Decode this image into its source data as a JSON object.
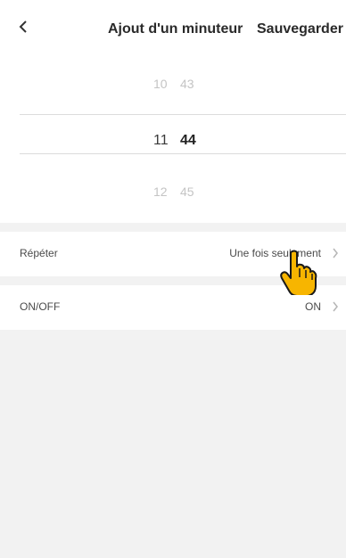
{
  "header": {
    "title": "Ajout d'un minuteur",
    "save_label": "Sauvegarder",
    "back_icon": "chevron-left-icon"
  },
  "time_picker": {
    "rows": [
      {
        "hour": "10",
        "minute": "43",
        "selected": false
      },
      {
        "hour": "11",
        "minute": "44",
        "selected": true
      },
      {
        "hour": "12",
        "minute": "45",
        "selected": false
      }
    ]
  },
  "settings": {
    "repeat": {
      "label": "Répéter",
      "value": "Une fois seulement"
    },
    "onoff": {
      "label": "ON/OFF",
      "value": "ON"
    }
  },
  "colors": {
    "background": "#f2f2f2",
    "card": "#ffffff",
    "cursor_fill": "#f7b500"
  }
}
